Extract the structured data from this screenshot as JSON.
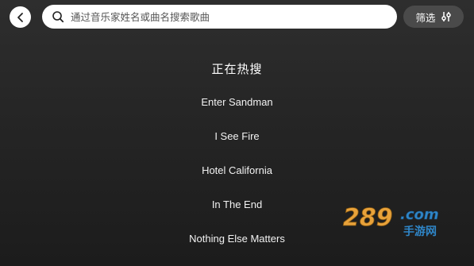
{
  "search": {
    "placeholder": "通过音乐家姓名或曲名搜索歌曲",
    "value": ""
  },
  "filter": {
    "label": "筛选"
  },
  "hot": {
    "title": "正在热搜",
    "items": [
      {
        "label": "Enter Sandman"
      },
      {
        "label": "I See Fire"
      },
      {
        "label": "Hotel California"
      },
      {
        "label": "In The End"
      },
      {
        "label": "Nothing Else Matters"
      }
    ]
  },
  "watermark": {
    "number": "289",
    "domain": ".com",
    "subtitle": "手游网",
    "colors": {
      "gold": "#e8a23a",
      "blue": "#2f86c8"
    }
  },
  "icons": {
    "back": "chevron-left-icon",
    "search": "search-icon",
    "filter": "sliders-icon"
  },
  "colors": {
    "background": "#262626",
    "search_bg": "#ffffff",
    "filter_bg": "#4a4a4a",
    "text": "#ffffff"
  }
}
